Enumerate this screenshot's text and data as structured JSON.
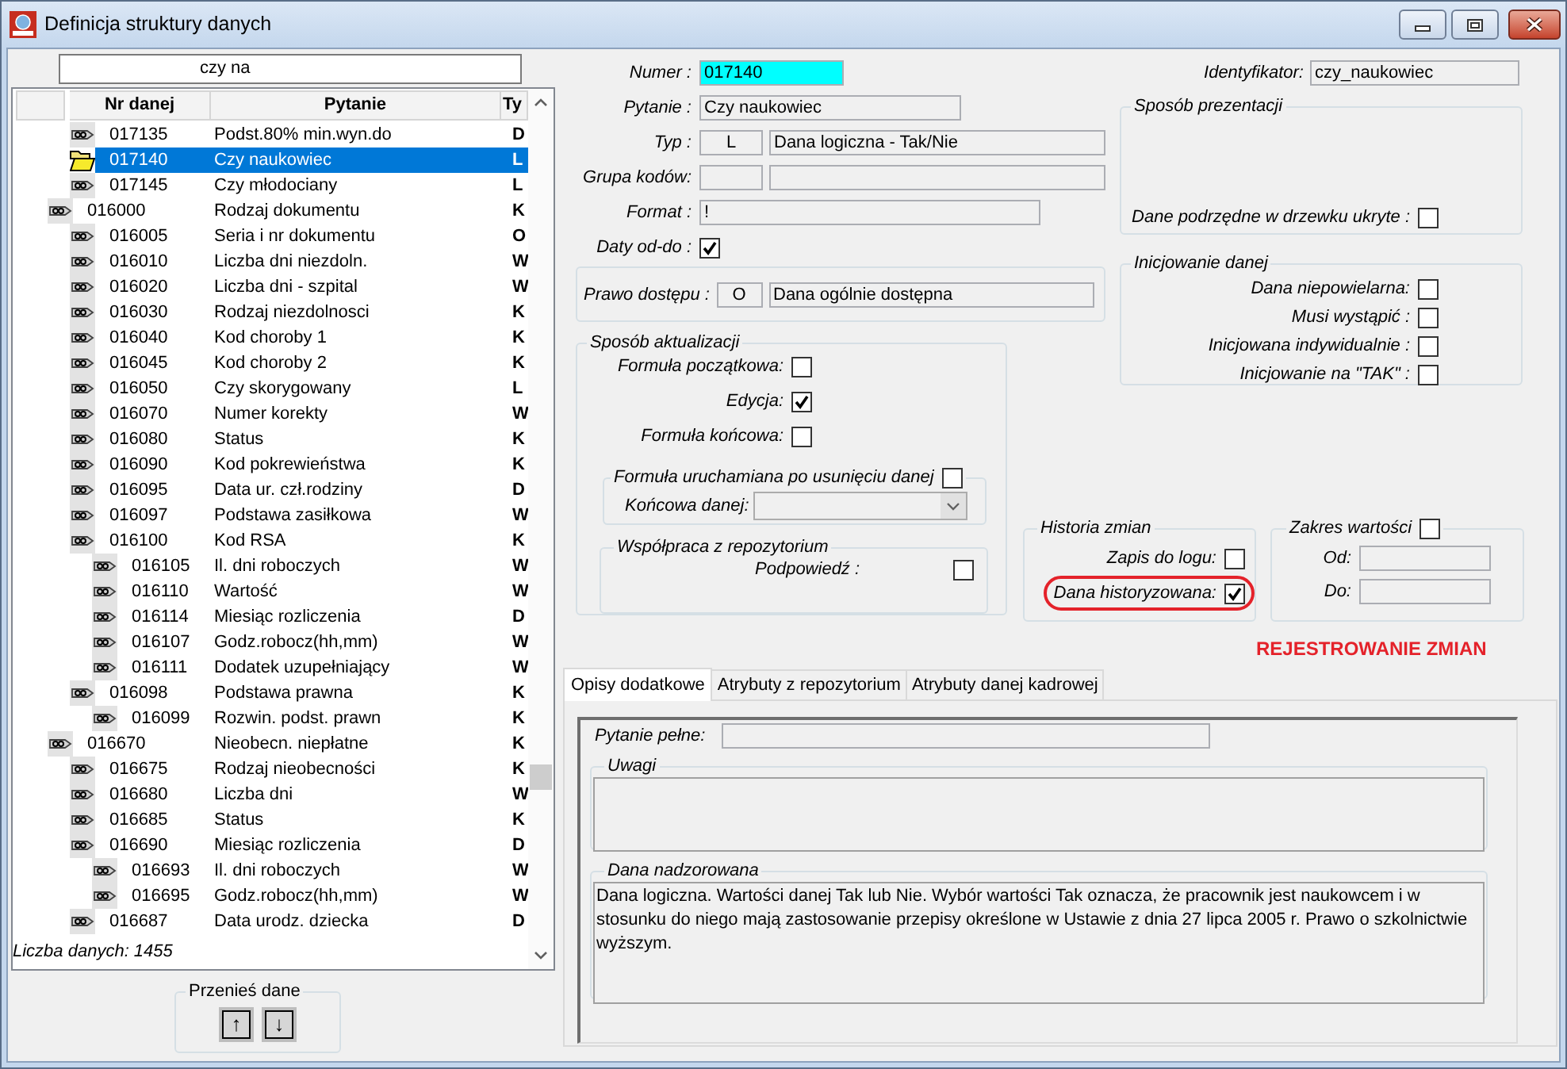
{
  "window": {
    "title": "Definicja struktury danych"
  },
  "search": {
    "value": "czy na"
  },
  "tree": {
    "columns": [
      "Nr danej",
      "Pytanie",
      "Ty"
    ],
    "items": [
      {
        "children": [
          {
            "nr": "017135",
            "pytanie": "Podst.80% min.wyn.do",
            "typ": "D",
            "selected": false
          },
          {
            "nr": "017140",
            "pytanie": "Czy naukowiec",
            "typ": "L",
            "selected": true
          },
          {
            "nr": "017145",
            "pytanie": "Czy młodociany",
            "typ": "L",
            "selected": false
          }
        ]
      },
      {
        "nr": "016000",
        "pytanie": "Rodzaj dokumentu",
        "typ": "K",
        "selected": false,
        "children": [
          {
            "nr": "016005",
            "pytanie": "Seria i nr dokumentu",
            "typ": "O",
            "selected": false
          },
          {
            "nr": "016010",
            "pytanie": "Liczba dni niezdoln.",
            "typ": "W",
            "selected": false
          },
          {
            "nr": "016020",
            "pytanie": "Liczba dni - szpital",
            "typ": "W",
            "selected": false
          },
          {
            "nr": "016030",
            "pytanie": "Rodzaj niezdolnosci",
            "typ": "K",
            "selected": false
          },
          {
            "nr": "016040",
            "pytanie": "Kod choroby 1",
            "typ": "K",
            "selected": false
          },
          {
            "nr": "016045",
            "pytanie": "Kod choroby 2",
            "typ": "K",
            "selected": false
          },
          {
            "nr": "016050",
            "pytanie": "Czy skorygowany",
            "typ": "L",
            "selected": false
          },
          {
            "nr": "016070",
            "pytanie": "Numer korekty",
            "typ": "W",
            "selected": false
          },
          {
            "nr": "016080",
            "pytanie": "Status",
            "typ": "K",
            "selected": false
          },
          {
            "nr": "016090",
            "pytanie": "Kod pokrewieństwa",
            "typ": "K",
            "selected": false
          },
          {
            "nr": "016095",
            "pytanie": "Data ur. czł.rodziny",
            "typ": "D",
            "selected": false
          },
          {
            "nr": "016097",
            "pytanie": "Podstawa zasiłkowa",
            "typ": "W",
            "selected": false
          },
          {
            "nr": "016100",
            "pytanie": "Kod RSA",
            "typ": "K",
            "selected": false,
            "children": [
              {
                "nr": "016105",
                "pytanie": "Il. dni roboczych",
                "typ": "W",
                "selected": false
              },
              {
                "nr": "016110",
                "pytanie": "Wartość",
                "typ": "W",
                "selected": false
              },
              {
                "nr": "016114",
                "pytanie": "Miesiąc rozliczenia",
                "typ": "D",
                "selected": false
              },
              {
                "nr": "016107",
                "pytanie": "Godz.robocz(hh,mm)",
                "typ": "W",
                "selected": false
              },
              {
                "nr": "016111",
                "pytanie": "Dodatek uzupełniający",
                "typ": "W",
                "selected": false
              }
            ]
          },
          {
            "nr": "016098",
            "pytanie": "Podstawa prawna",
            "typ": "K",
            "selected": false,
            "children": [
              {
                "nr": "016099",
                "pytanie": "Rozwin. podst. prawn",
                "typ": "K",
                "selected": false
              }
            ]
          }
        ]
      },
      {
        "nr": "016670",
        "pytanie": "Nieobecn. niepłatne",
        "typ": "K",
        "selected": false,
        "children": [
          {
            "nr": "016675",
            "pytanie": "Rodzaj nieobecności",
            "typ": "K",
            "selected": false
          },
          {
            "nr": "016680",
            "pytanie": "Liczba dni",
            "typ": "W",
            "selected": false
          },
          {
            "nr": "016685",
            "pytanie": "Status",
            "typ": "K",
            "selected": false
          },
          {
            "nr": "016690",
            "pytanie": "Miesiąc rozliczenia",
            "typ": "D",
            "selected": false,
            "children": [
              {
                "nr": "016693",
                "pytanie": "Il. dni roboczych",
                "typ": "W",
                "selected": false
              },
              {
                "nr": "016695",
                "pytanie": "Godz.robocz(hh,mm)",
                "typ": "W",
                "selected": false
              }
            ]
          },
          {
            "nr": "016687",
            "pytanie": "Data urodz. dziecka",
            "typ": "D",
            "selected": false
          }
        ]
      }
    ],
    "footer": "Liczba danych: 1455"
  },
  "move": {
    "title": "Przenieś dane",
    "buttons": [
      "↑",
      "↓"
    ]
  },
  "details": {
    "numer": {
      "label": "Numer :",
      "value": "017140"
    },
    "pytanie": {
      "label": "Pytanie :",
      "value": "Czy naukowiec"
    },
    "typ": {
      "label": "Typ :",
      "code": "L",
      "description": "Dana logiczna - Tak/Nie"
    },
    "grupa_kodow": {
      "label": "Grupa kodów:"
    },
    "format": {
      "label": "Format :",
      "value": "!"
    },
    "daty_od_do": {
      "label": "Daty od-do :",
      "checked": true
    },
    "prawo_dostepu": {
      "label": "Prawo dostępu :",
      "code": "O",
      "description": "Dana ogólnie dostępna"
    },
    "identyfikator": {
      "label": "Identyfikator:",
      "value": "czy_naukowiec"
    },
    "sposob_prezentacji": {
      "title": "Sposób prezentacji",
      "options": [
        {
          "label": "Dane podrzędne w drzewku ukryte :",
          "checked": false
        }
      ]
    },
    "inicjowanie_danej": {
      "title": "Inicjowanie danej",
      "options": [
        {
          "label": "Dana niepowielarna:",
          "checked": false
        },
        {
          "label": "Musi wystąpić :",
          "checked": false
        },
        {
          "label": "Inicjowana indywidualnie :",
          "checked": false
        },
        {
          "label": "Inicjowanie na \"TAK\" :",
          "checked": false
        }
      ]
    },
    "sposob_aktualizacji": {
      "title": "Sposób aktualizacji",
      "options": [
        {
          "label": "Formuła początkowa:",
          "checked": false
        },
        {
          "label": "Edycja:",
          "checked": true
        },
        {
          "label": "Formuła końcowa:",
          "checked": false
        }
      ],
      "formula_po_usunieciu": {
        "title": "Formuła uruchamiana po usunięciu danej",
        "checked": false,
        "dropdown": {
          "label": "Końcowa danej:"
        }
      },
      "wspolpraca_z_repozytorium": {
        "title": "Współpraca z repozytorium",
        "options": [
          {
            "label": "Podpowiedź :",
            "checked": false
          }
        ]
      }
    },
    "historia_zmian": {
      "title": "Historia zmian",
      "options": [
        {
          "label": "Zapis do logu:",
          "checked": false,
          "circled": false
        },
        {
          "label": "Dana historyzowana:",
          "checked": true,
          "circled": true
        }
      ]
    },
    "zakres_wartosci": {
      "title": "Zakres wartości",
      "checked": false,
      "fields": [
        {
          "label": "Od:"
        },
        {
          "label": "Do:"
        }
      ]
    },
    "annotation": "REJESTROWANIE ZMIAN"
  },
  "tabs": [
    {
      "label": "Opisy dodatkowe",
      "selected": true
    },
    {
      "label": "Atrybuty z repozytorium",
      "selected": false
    },
    {
      "label": "Atrybuty danej kadrowej",
      "selected": false
    }
  ],
  "tab_panel": {
    "pytanie_pelne": {
      "label": "Pytanie pełne:"
    },
    "uwagi": {
      "title": "Uwagi"
    },
    "dana_nadzorowana": {
      "title": "Dana nadzorowana",
      "value": "Dana logiczna. Wartości danej Tak lub Nie. Wybór wartości Tak oznacza, że pracownik jest naukowcem i w stosunku do niego mają zastosowanie przepisy określone w Ustawie z dnia 27 lipca 2005 r. Prawo o szkolnictwie wyższym."
    }
  }
}
